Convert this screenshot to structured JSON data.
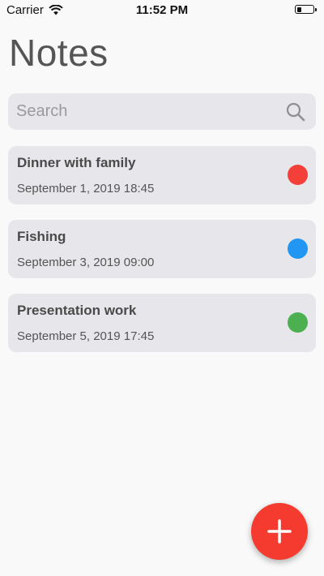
{
  "status_bar": {
    "carrier": "Carrier",
    "time": "11:52 PM"
  },
  "page_title": "Notes",
  "search": {
    "placeholder": "Search",
    "value": ""
  },
  "notes": [
    {
      "title": "Dinner with family",
      "date": "September 1, 2019 18:45",
      "color": "#f5403a"
    },
    {
      "title": "Fishing",
      "date": "September 3, 2019 09:00",
      "color": "#2196f3"
    },
    {
      "title": "Presentation work",
      "date": "September 5, 2019 17:45",
      "color": "#4caf50"
    }
  ],
  "icons": {
    "search": "search-icon",
    "add": "plus-icon",
    "wifi": "wifi-icon",
    "battery": "battery-icon"
  },
  "colors": {
    "accent": "#f53b30",
    "card": "#e7e6ea"
  }
}
